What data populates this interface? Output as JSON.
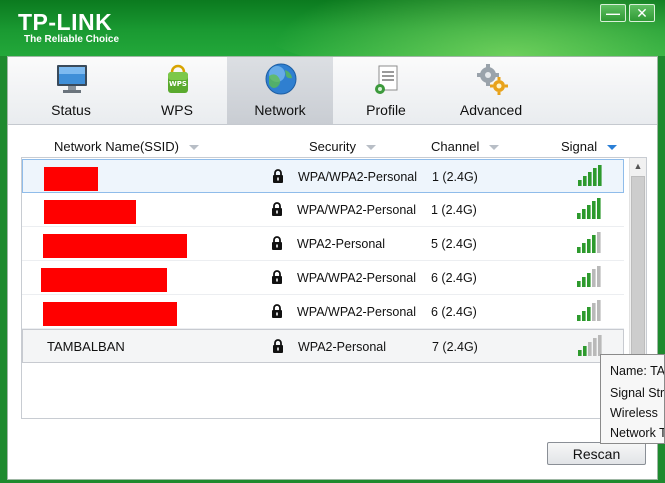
{
  "app": {
    "brand": "TP-LINK",
    "tagline": "The Reliable Choice",
    "minimize_glyph": "—",
    "close_glyph": "✕"
  },
  "tabs": [
    {
      "label": "Status",
      "icon": "monitor-icon"
    },
    {
      "label": "WPS",
      "icon": "wps-icon"
    },
    {
      "label": "Network",
      "icon": "globe-icon",
      "active": true
    },
    {
      "label": "Profile",
      "icon": "profile-icon"
    },
    {
      "label": "Advanced",
      "icon": "gears-icon"
    }
  ],
  "columns": {
    "ssid": "Network Name(SSID)",
    "security": "Security",
    "channel": "Channel",
    "signal": "Signal",
    "sorted_by": "signal"
  },
  "networks": [
    {
      "ssid": "",
      "redacted": true,
      "locked": true,
      "security": "WPA/WPA2-Personal",
      "channel": "1 (2.4G)",
      "signal_bars": 5,
      "selected": true
    },
    {
      "ssid": "",
      "redacted": true,
      "locked": true,
      "security": "WPA/WPA2-Personal",
      "channel": "1 (2.4G)",
      "signal_bars": 5
    },
    {
      "ssid": "",
      "redacted": true,
      "locked": true,
      "security": "WPA2-Personal",
      "channel": "5 (2.4G)",
      "signal_bars": 4
    },
    {
      "ssid": "",
      "redacted": true,
      "locked": true,
      "security": "WPA/WPA2-Personal",
      "channel": "6 (2.4G)",
      "signal_bars": 3
    },
    {
      "ssid": "",
      "redacted": true,
      "locked": true,
      "security": "WPA/WPA2-Personal",
      "channel": "6 (2.4G)",
      "signal_bars": 3
    },
    {
      "ssid": "TAMBALBAN",
      "redacted": false,
      "locked": true,
      "security": "WPA2-Personal",
      "channel": "7 (2.4G)",
      "signal_bars": 2,
      "hover": true
    }
  ],
  "tooltip": {
    "lines": [
      "Name:  TA",
      "Signal Str",
      "Wireless",
      "Network T"
    ]
  },
  "rescan_label": "Rescan",
  "colors": {
    "brand_green": "#1a9a32",
    "signal_on": "#2d9a2d",
    "signal_off": "#b9b9b9",
    "redaction": "#ff0000",
    "sort_arrow": "#2a7fd6"
  }
}
